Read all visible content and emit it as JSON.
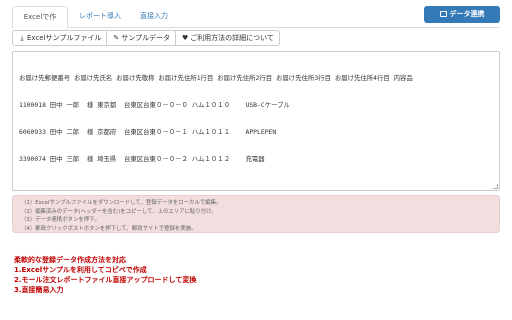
{
  "tabs": [
    {
      "label": "Excelで作成",
      "active": true
    },
    {
      "label": "レポート導入",
      "active": false
    },
    {
      "label": "直接入力",
      "active": false
    }
  ],
  "primary_button": {
    "label": "データ連携",
    "icon": "external-link-icon"
  },
  "toolbar": {
    "sample_file": {
      "label": "Excelサンプルファイル",
      "icon": "download-icon"
    },
    "sample_data": {
      "label": "サンプルデータ",
      "icon": "pencil-icon"
    },
    "usage": {
      "label": "ご利用方法の詳細について",
      "icon": "heart-icon"
    }
  },
  "data_text": {
    "header": "お届け先郵便番号 お届け先氏名 お届け先敬称 お届け先住所1行目 お届け先住所2行目 お届け先住所3行目 お届け先住所4行目 内容品",
    "rows": [
      "1100018 田中 一郎  様 東京都  台東区台東０－０－０ ハム１０１０    USB-Cケーブル",
      "6060933 田中 二郎  様 京都府  台東区台東０－０－１ ハム１０１１    APPLEPEN",
      "3390074 田中 三郎  様 埼玉県  台東区台東０－０－２ ハム１０１２    充電器"
    ]
  },
  "notice": [
    "（1）Excelサンプルファイルをダウンロードして、登録データをローカルで編集。",
    "（2）編集済みのデータ(ヘッダーを含む)をコピーして、上のエリアに貼り付け。",
    "（3）データ連携ボタンを押下。",
    "（4）郵政クリックポストボタンを押下して、郵政サイトで登録を実施。"
  ],
  "guide": {
    "title": "柔軟的な登録データ作成方法を対応",
    "items": [
      "1.Excelサンプルを利用してコピペで作成",
      "2.モール注文レポートファイル直接アップロードして変換",
      "3.直接簡易入力"
    ]
  },
  "colors": {
    "primary": "#337ab7",
    "notice_bg": "#f2dede",
    "guide_text": "#c00000"
  }
}
